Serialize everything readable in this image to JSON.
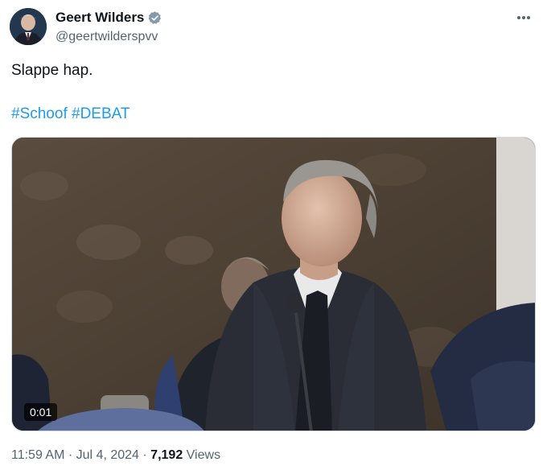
{
  "author": {
    "display_name": "Geert Wilders",
    "handle": "@geertwilderspvv",
    "verified_icon": "verified-badge-icon",
    "avatar_icon": "profile-photo"
  },
  "tweet": {
    "text": "Slappe hap.",
    "hashtags": [
      "#Schoof",
      "#DEBAT"
    ]
  },
  "media": {
    "type": "video",
    "timecode": "0:01"
  },
  "meta": {
    "time": "11:59 AM",
    "separator": "·",
    "date": "Jul 4, 2024",
    "views_count": "7,192",
    "views_label": "Views"
  },
  "colors": {
    "link": "#1d9bf0",
    "secondary_text": "#536471",
    "primary_text": "#0f1419",
    "verified": "#829aab"
  }
}
